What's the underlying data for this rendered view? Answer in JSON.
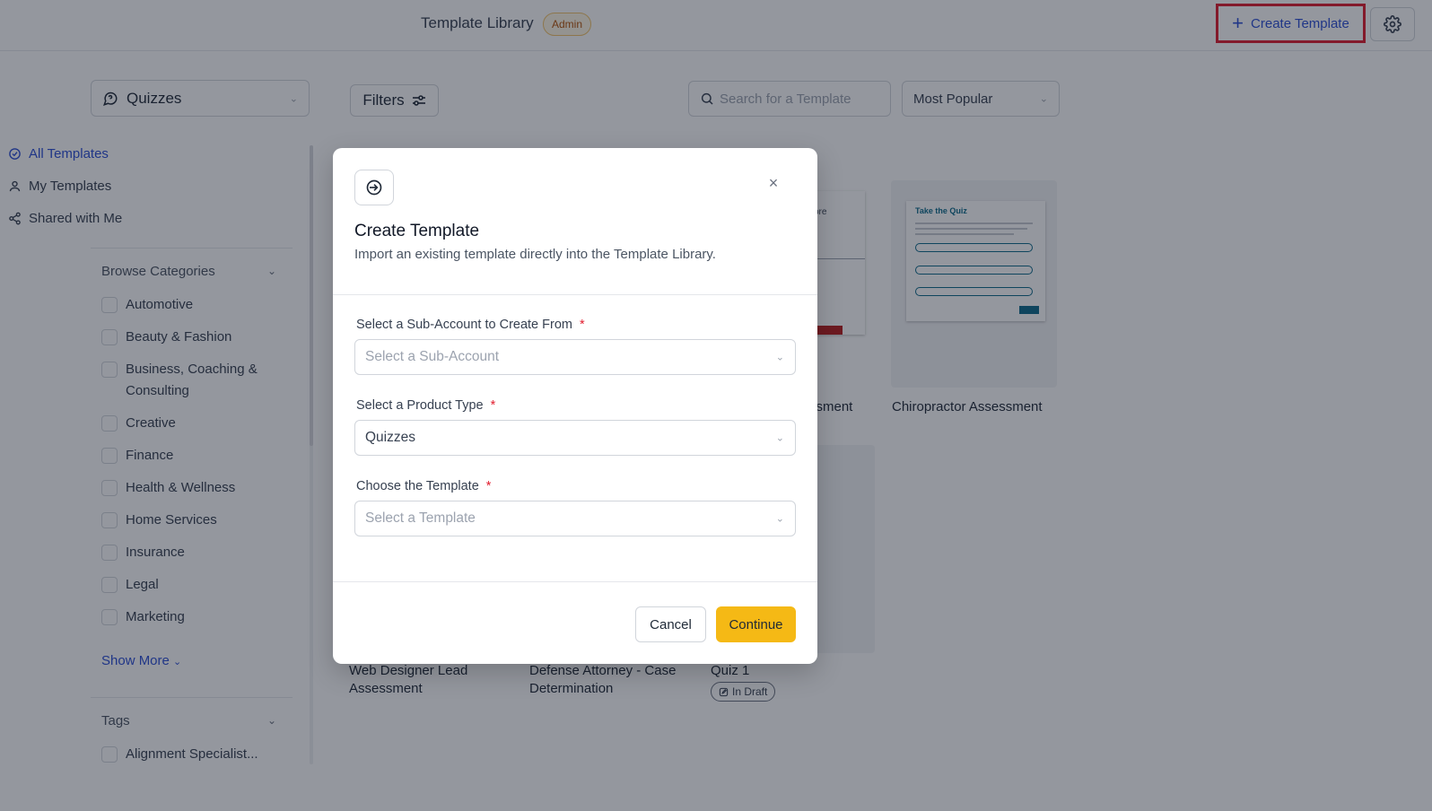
{
  "header": {
    "title": "Template Library",
    "badge": "Admin",
    "create_label": "Create Template"
  },
  "toolbar": {
    "product": "Quizzes",
    "filters_label": "Filters",
    "search_placeholder": "Search for a Template",
    "sort": "Most Popular"
  },
  "sidebar": {
    "nav": [
      {
        "label": "All Templates"
      },
      {
        "label": "My Templates"
      },
      {
        "label": "Shared with Me"
      }
    ],
    "categories_title": "Browse Categories",
    "categories": [
      "Automotive",
      "Beauty & Fashion",
      "Business, Coaching &",
      "Consulting",
      "Creative",
      "Finance",
      "Health & Wellness",
      "Home Services",
      "Insurance",
      "Legal",
      "Marketing"
    ],
    "show_more": "Show More",
    "tags_title": "Tags",
    "tags": [
      "Alignment Specialist..."
    ]
  },
  "cards": {
    "chiropractor": "Chiropractor Assessment",
    "partial_assessment": "ssment",
    "web_designer": [
      "Web Designer Lead",
      "Assessment"
    ],
    "defense_attorney": [
      "Defense Attorney - Case",
      "Determination"
    ],
    "quiz1": "Quiz 1",
    "draft_badge": "In Draft",
    "preview_title": "Take the Quiz",
    "partial_preview_text": "ore"
  },
  "modal": {
    "title": "Create Template",
    "subtitle": "Import an existing template directly into the Template Library.",
    "subaccount_label": "Select a Sub-Account to Create From",
    "subaccount_placeholder": "Select a Sub-Account",
    "product_label": "Select a Product Type",
    "product_value": "Quizzes",
    "template_label": "Choose the Template",
    "template_placeholder": "Select a Template",
    "required_mark": "*",
    "cancel": "Cancel",
    "continue": "Continue"
  },
  "colors": {
    "accent": "#2d4fd6",
    "continue_button": "#f5b915",
    "highlight_border": "#e11d2e"
  }
}
